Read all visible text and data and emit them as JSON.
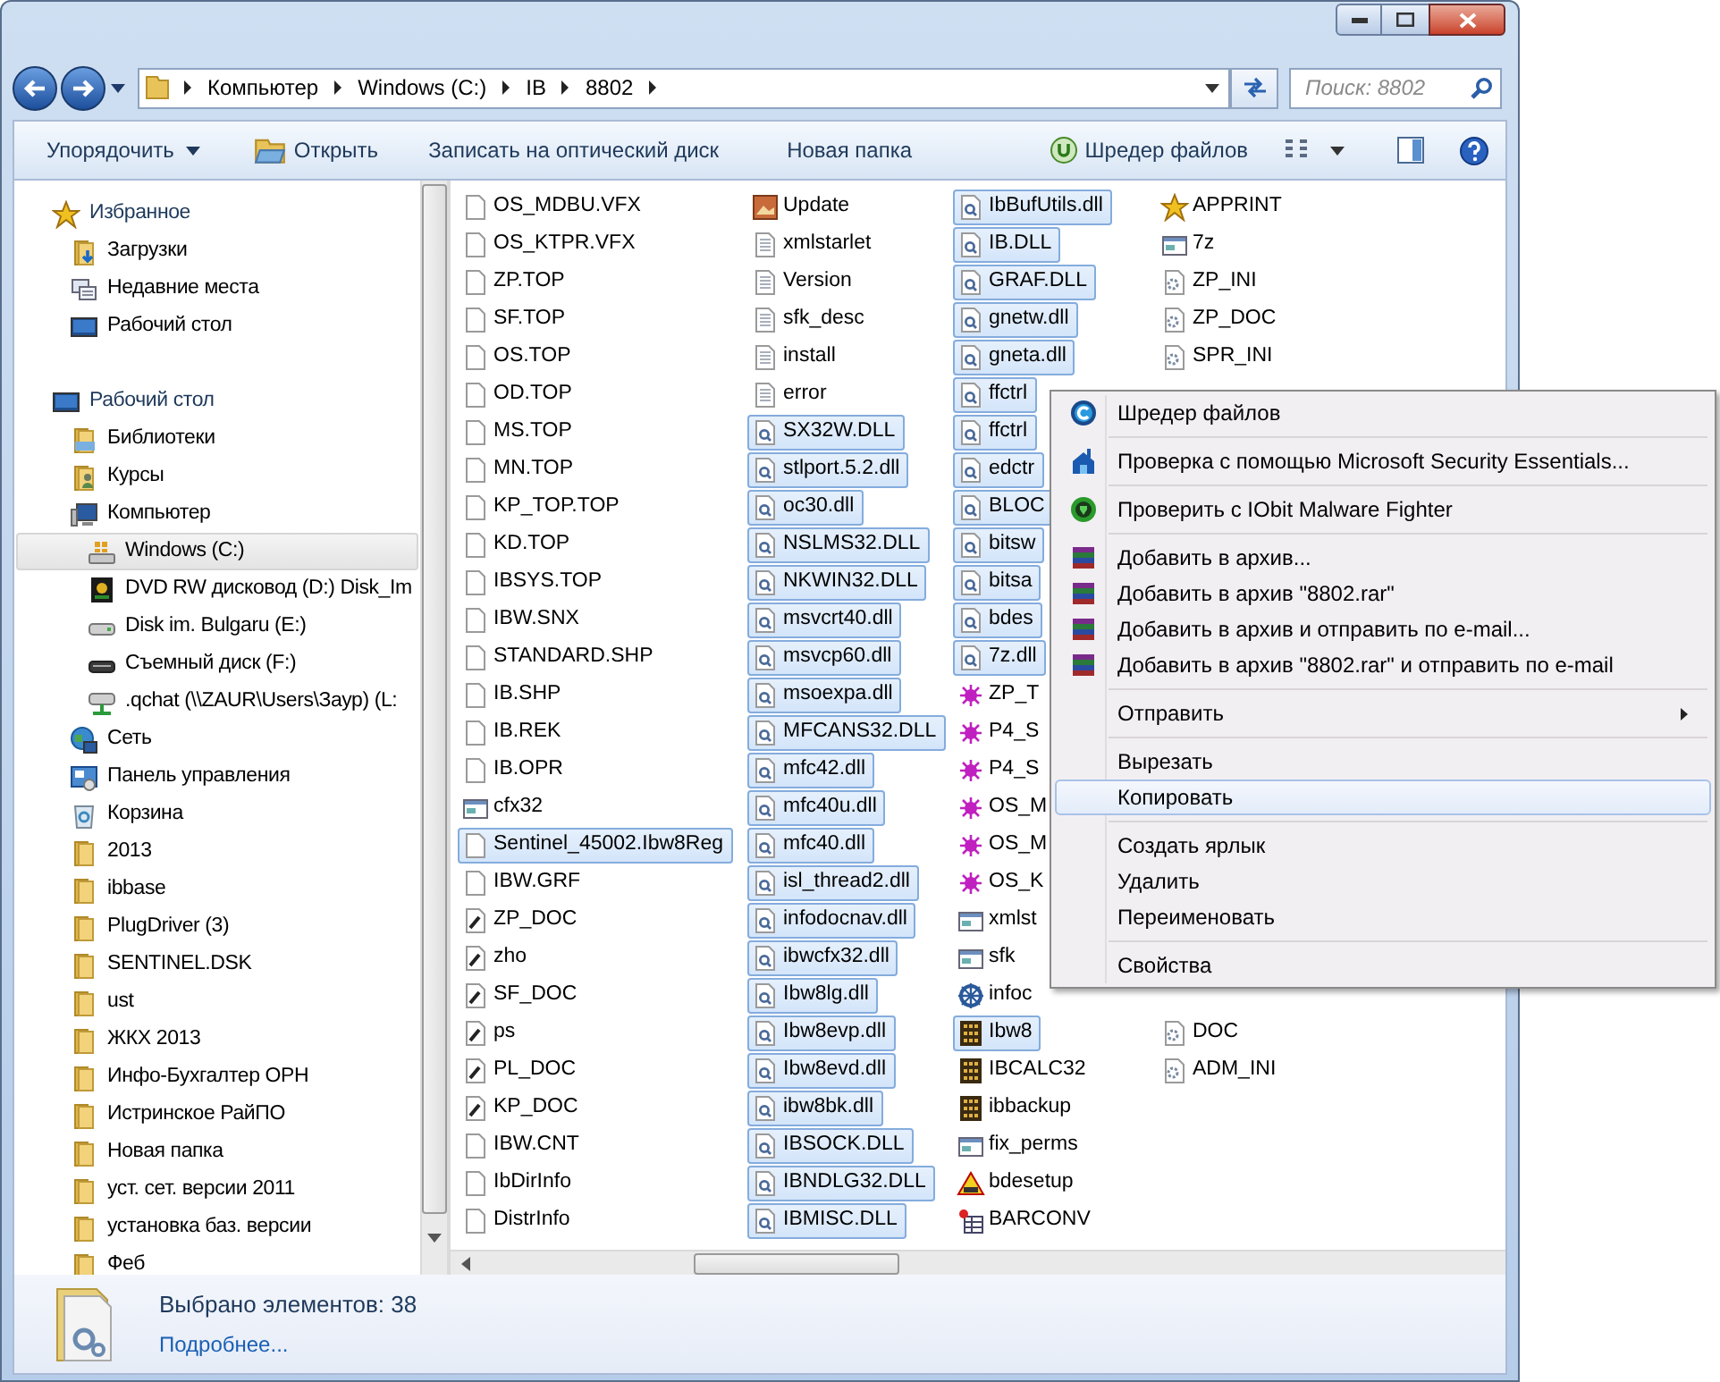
{
  "address": {
    "crumbs": [
      "Компьютер",
      "Windows (C:)",
      "IB",
      "8802"
    ]
  },
  "search": {
    "placeholder": "Поиск: 8802"
  },
  "toolbar": {
    "buttons": [
      {
        "label": "Упорядочить",
        "kind": "dropdown"
      },
      {
        "label": "Открыть",
        "kind": "open"
      },
      {
        "label": "Записать на оптический диск",
        "kind": "plain"
      },
      {
        "label": "Новая папка",
        "kind": "plain"
      }
    ],
    "right_buttons": [
      {
        "label": "Шредер файлов",
        "kind": "shredder"
      }
    ]
  },
  "sidebar": {
    "items": [
      {
        "label": "Избранное",
        "kind": "star",
        "selected": false,
        "children": [
          {
            "label": "Загрузки",
            "kind": "downloads",
            "selected": false
          },
          {
            "label": "Недавние места",
            "kind": "recent",
            "selected": false
          },
          {
            "label": "Рабочий стол",
            "kind": "desktop",
            "selected": false
          }
        ]
      },
      {
        "label": "Рабочий стол",
        "kind": "desktop",
        "selected": false,
        "children": [
          {
            "label": "Библиотеки",
            "kind": "libraries",
            "selected": false
          },
          {
            "label": "Курсы",
            "kind": "user",
            "selected": false
          },
          {
            "label": "Компьютер",
            "kind": "computer",
            "selected": false,
            "children": [
              {
                "label": "Windows (C:)",
                "kind": "windrive",
                "selected": true
              },
              {
                "label": "DVD RW дисковод (D:) Disk_Im",
                "kind": "dvd",
                "selected": false
              },
              {
                "label": "Disk im. Bulgaru (E:)",
                "kind": "hdd",
                "selected": false
              },
              {
                "label": "Съемный диск (F:)",
                "kind": "removable",
                "selected": false
              },
              {
                "label": ".qchat (\\\\ZAUR\\Users\\Заур) (L:",
                "kind": "netdrive",
                "selected": false
              }
            ]
          },
          {
            "label": "Сеть",
            "kind": "network",
            "selected": false
          },
          {
            "label": "Панель управления",
            "kind": "control",
            "selected": false
          },
          {
            "label": "Корзина",
            "kind": "recycle",
            "selected": false
          },
          {
            "label": "2013",
            "kind": "folder",
            "selected": false
          },
          {
            "label": "ibbase",
            "kind": "folder",
            "selected": false
          },
          {
            "label": "PlugDriver (3)",
            "kind": "folder",
            "selected": false
          },
          {
            "label": "SENTINEL.DSK",
            "kind": "folder",
            "selected": false
          },
          {
            "label": "ust",
            "kind": "folder",
            "selected": false
          },
          {
            "label": "ЖКХ 2013",
            "kind": "folder",
            "selected": false
          },
          {
            "label": "Инфо-Бухгалтер ОРН",
            "kind": "folder",
            "selected": false
          },
          {
            "label": "Истринское РайПО",
            "kind": "folder",
            "selected": false
          },
          {
            "label": "Новая папка",
            "kind": "folder",
            "selected": false
          },
          {
            "label": "уст. сет. версии 2011",
            "kind": "folder",
            "selected": false
          },
          {
            "label": "установка баз. версии",
            "kind": "folder",
            "selected": false
          },
          {
            "label": "Феб",
            "kind": "folder",
            "selected": false
          }
        ]
      }
    ]
  },
  "files": {
    "columns": [
      {
        "groups": [
          {
            "items": [
              {
                "name": "OS_MDBU.VFX",
                "kind": "blank",
                "selected": false
              },
              {
                "name": "OS_KTPR.VFX",
                "kind": "blank",
                "selected": false
              },
              {
                "name": "ZP.TOP",
                "kind": "blank",
                "selected": false
              },
              {
                "name": "SF.TOP",
                "kind": "blank",
                "selected": false
              },
              {
                "name": "OS.TOP",
                "kind": "blank",
                "selected": false
              },
              {
                "name": "OD.TOP",
                "kind": "blank",
                "selected": false
              },
              {
                "name": "MS.TOP",
                "kind": "blank",
                "selected": false
              },
              {
                "name": "MN.TOP",
                "kind": "blank",
                "selected": false
              },
              {
                "name": "KP_TOP.TOP",
                "kind": "blank",
                "selected": false
              },
              {
                "name": "KD.TOP",
                "kind": "blank",
                "selected": false
              },
              {
                "name": "IBSYS.TOP",
                "kind": "blank",
                "selected": false
              },
              {
                "name": "IBW.SNX",
                "kind": "blank",
                "selected": false
              },
              {
                "name": "STANDARD.SHP",
                "kind": "blank",
                "selected": false
              },
              {
                "name": "IB.SHP",
                "kind": "blank",
                "selected": false
              },
              {
                "name": "IB.REK",
                "kind": "blank",
                "selected": false
              },
              {
                "name": "IB.OPR",
                "kind": "blank",
                "selected": false
              },
              {
                "name": "cfx32",
                "kind": "window",
                "selected": false
              },
              {
                "name": "Sentinel_45002.Ibw8Reg",
                "kind": "blank",
                "selected": true
              },
              {
                "name": "IBW.GRF",
                "kind": "blank",
                "selected": false
              },
              {
                "name": "ZP_DOC",
                "kind": "script",
                "selected": false
              },
              {
                "name": "zho",
                "kind": "script",
                "selected": false
              },
              {
                "name": "SF_DOC",
                "kind": "script",
                "selected": false
              },
              {
                "name": "ps",
                "kind": "script",
                "selected": false
              },
              {
                "name": "PL_DOC",
                "kind": "script",
                "selected": false
              },
              {
                "name": "KP_DOC",
                "kind": "script",
                "selected": false
              },
              {
                "name": "IBW.CNT",
                "kind": "blank",
                "selected": false
              },
              {
                "name": "IbDirInfo",
                "kind": "blank",
                "selected": false
              },
              {
                "name": "DistrInfo",
                "kind": "blank",
                "selected": false
              }
            ]
          }
        ]
      },
      {
        "groups": [
          {
            "items": [
              {
                "name": "Update",
                "kind": "image",
                "selected": false
              },
              {
                "name": "xmlstarlet",
                "kind": "text",
                "selected": false
              },
              {
                "name": "Version",
                "kind": "text",
                "selected": false
              },
              {
                "name": "sfk_desc",
                "kind": "text",
                "selected": false
              },
              {
                "name": "install",
                "kind": "text",
                "selected": false
              },
              {
                "name": "error",
                "kind": "text",
                "selected": false
              },
              {
                "name": "SX32W.DLL",
                "kind": "dll",
                "selected": true
              },
              {
                "name": "stlport.5.2.dll",
                "kind": "dll",
                "selected": true
              },
              {
                "name": "oc30.dll",
                "kind": "dll",
                "selected": true
              },
              {
                "name": "NSLMS32.DLL",
                "kind": "dll",
                "selected": true
              },
              {
                "name": "NKWIN32.DLL",
                "kind": "dll",
                "selected": true
              },
              {
                "name": "msvcrt40.dll",
                "kind": "dll",
                "selected": true
              },
              {
                "name": "msvcp60.dll",
                "kind": "dll",
                "selected": true
              },
              {
                "name": "msoexpa.dll",
                "kind": "dll",
                "selected": true
              },
              {
                "name": "MFCANS32.DLL",
                "kind": "dll",
                "selected": true
              },
              {
                "name": "mfc42.dll",
                "kind": "dll",
                "selected": true
              },
              {
                "name": "mfc40u.dll",
                "kind": "dll",
                "selected": true
              },
              {
                "name": "mfc40.dll",
                "kind": "dll",
                "selected": true
              },
              {
                "name": "isl_thread2.dll",
                "kind": "dll",
                "selected": true
              },
              {
                "name": "infodocnav.dll",
                "kind": "dll",
                "selected": true
              },
              {
                "name": "ibwcfx32.dll",
                "kind": "dll",
                "selected": true
              },
              {
                "name": "Ibw8lg.dll",
                "kind": "dll",
                "selected": true
              },
              {
                "name": "Ibw8evp.dll",
                "kind": "dll",
                "selected": true
              },
              {
                "name": "Ibw8evd.dll",
                "kind": "dll",
                "selected": true
              },
              {
                "name": "ibw8bk.dll",
                "kind": "dll",
                "selected": true
              },
              {
                "name": "IBSOCK.DLL",
                "kind": "dll",
                "selected": true
              },
              {
                "name": "IBNDLG32.DLL",
                "kind": "dll",
                "selected": true
              },
              {
                "name": "IBMISC.DLL",
                "kind": "dll",
                "selected": true
              }
            ]
          }
        ]
      },
      {
        "groups": [
          {
            "items": [
              {
                "name": "IbBufUtils.dll",
                "kind": "dll",
                "selected": true
              },
              {
                "name": "IB.DLL",
                "kind": "dll",
                "selected": true
              },
              {
                "name": "GRAF.DLL",
                "kind": "dll",
                "selected": true
              },
              {
                "name": "gnetw.dll",
                "kind": "dll",
                "selected": true
              },
              {
                "name": "gneta.dll",
                "kind": "dll",
                "selected": true
              },
              {
                "name": "ffctrl",
                "kind": "dll",
                "selected": true
              },
              {
                "name": "ffctrl",
                "kind": "dll",
                "selected": true
              },
              {
                "name": "edctr",
                "kind": "dll",
                "selected": true
              },
              {
                "name": "BLOC",
                "kind": "dll",
                "selected": true
              },
              {
                "name": "bitsw",
                "kind": "dll",
                "selected": true
              },
              {
                "name": "bitsa",
                "kind": "dll",
                "selected": true
              },
              {
                "name": "bdes",
                "kind": "dll",
                "selected": true
              },
              {
                "name": "7z.dll",
                "kind": "dll",
                "selected": true
              },
              {
                "name": "ZP_T",
                "kind": "bug",
                "selected": false
              },
              {
                "name": "P4_S",
                "kind": "bug",
                "selected": false
              },
              {
                "name": "P4_S",
                "kind": "bug",
                "selected": false
              },
              {
                "name": "OS_M",
                "kind": "bug",
                "selected": false
              },
              {
                "name": "OS_M",
                "kind": "bug",
                "selected": false
              },
              {
                "name": "OS_K",
                "kind": "bug",
                "selected": false
              },
              {
                "name": "xmlst",
                "kind": "window",
                "selected": false
              },
              {
                "name": "sfk",
                "kind": "window",
                "selected": false
              },
              {
                "name": "infoc",
                "kind": "wheel",
                "selected": false
              },
              {
                "name": "Ibw8",
                "kind": "abacus",
                "selected": true
              },
              {
                "name": "IBCALC32",
                "kind": "abacus",
                "selected": false
              },
              {
                "name": "ibbackup",
                "kind": "abacus",
                "selected": false
              },
              {
                "name": "fix_perms",
                "kind": "window",
                "selected": false
              },
              {
                "name": "bdesetup",
                "kind": "setup",
                "selected": false
              },
              {
                "name": "BARCONV",
                "kind": "table",
                "selected": false
              }
            ]
          }
        ]
      },
      {
        "groups": [
          {
            "items": [
              {
                "name": "APPRINT",
                "kind": "star",
                "selected": false
              },
              {
                "name": "7z",
                "kind": "window",
                "selected": false
              },
              {
                "name": "ZP_INI",
                "kind": "gear",
                "selected": false
              },
              {
                "name": "ZP_DOC",
                "kind": "gear",
                "selected": false
              },
              {
                "name": "SPR_INI",
                "kind": "gear",
                "selected": false
              }
            ]
          },
          {
            "items": [
              {
                "name": "DOC",
                "kind": "gear",
                "selected": false
              },
              {
                "name": "ADM_INI",
                "kind": "gear",
                "selected": false
              }
            ]
          }
        ]
      }
    ]
  },
  "context_menu": {
    "items": [
      {
        "kind": "shredder",
        "label": "Шредер файлов",
        "selected": false
      },
      {
        "kind": "separator"
      },
      {
        "kind": "mse",
        "label": "Проверка с помощью Microsoft Security Essentials...",
        "selected": false
      },
      {
        "kind": "separator"
      },
      {
        "kind": "iobit",
        "label": "Проверить с IObit Malware Fighter",
        "selected": false
      },
      {
        "kind": "separator"
      },
      {
        "kind": "rar",
        "label": "Добавить в архив...",
        "selected": false
      },
      {
        "kind": "rar",
        "label": "Добавить в архив \"8802.rar\"",
        "selected": false
      },
      {
        "kind": "rar",
        "label": "Добавить в архив и отправить по e-mail...",
        "selected": false
      },
      {
        "kind": "rar",
        "label": "Добавить в архив \"8802.rar\" и отправить по e-mail",
        "selected": false
      },
      {
        "kind": "separator"
      },
      {
        "kind": "plain",
        "label": "Отправить",
        "selected": false,
        "submenu": true
      },
      {
        "kind": "separator"
      },
      {
        "kind": "plain",
        "label": "Вырезать",
        "selected": false
      },
      {
        "kind": "plain",
        "label": "Копировать",
        "selected": true
      },
      {
        "kind": "separator"
      },
      {
        "kind": "plain",
        "label": "Создать ярлык",
        "selected": false
      },
      {
        "kind": "plain",
        "label": "Удалить",
        "selected": false
      },
      {
        "kind": "plain",
        "label": "Переименовать",
        "selected": false
      },
      {
        "kind": "separator"
      },
      {
        "kind": "plain",
        "label": "Свойства",
        "selected": false
      }
    ]
  },
  "details": {
    "summary": "Выбрано элементов: 38",
    "link": "Подробнее..."
  }
}
